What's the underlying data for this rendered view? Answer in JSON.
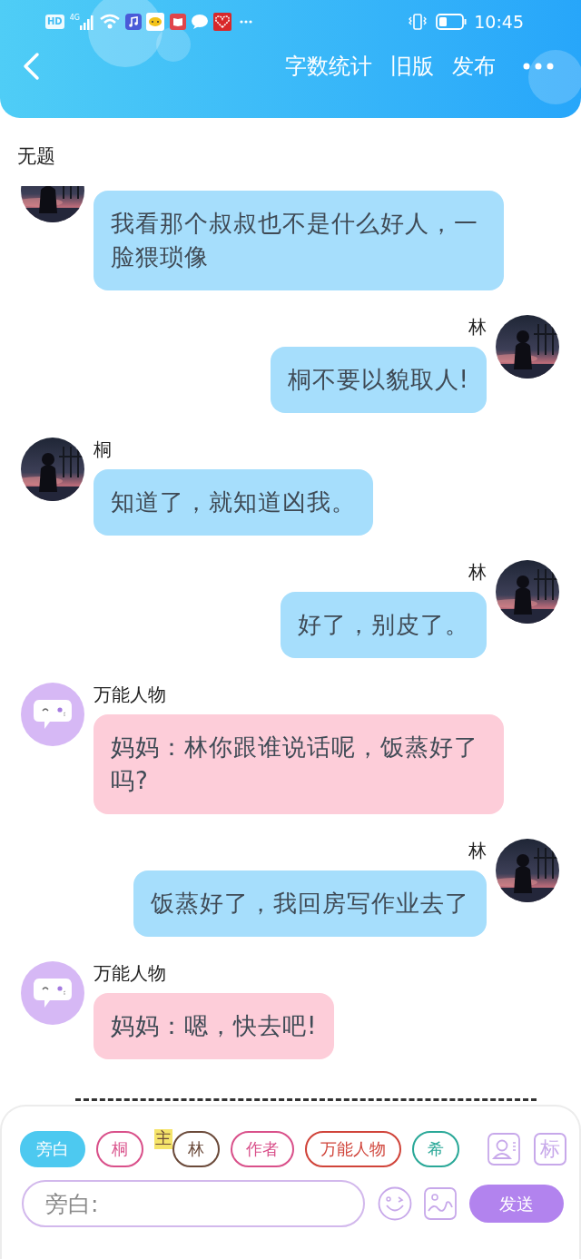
{
  "status_bar": {
    "hd": "HD",
    "network": "4G",
    "time": "10:45"
  },
  "toolbar": {
    "actions": [
      "字数统计",
      "旧版",
      "发布"
    ]
  },
  "title": "无题",
  "messages": [
    {
      "outgoing": false,
      "text": "我看那个叔叔也不是什么好人，一脸猥琐像",
      "color": "#a6defc"
    },
    {
      "outgoing": true,
      "name": "林",
      "text": "桐不要以貌取人!",
      "color": "#a6defc"
    },
    {
      "outgoing": false,
      "name": "桐",
      "text": "知道了，就知道凶我。",
      "color": "#a6defc"
    },
    {
      "outgoing": true,
      "name": "林",
      "text": "好了，别皮了。",
      "color": "#a6defc"
    },
    {
      "outgoing": false,
      "kind": "universal",
      "name": "万能人物",
      "text": "妈妈：林你跟谁说话呢，饭蒸好了吗?",
      "color": "#fdcdd9"
    },
    {
      "outgoing": true,
      "name": "林",
      "text": "饭蒸好了，我回房写作业去了",
      "color": "#a6defc"
    },
    {
      "outgoing": false,
      "kind": "universal",
      "name": "万能人物",
      "text": "妈妈：嗯，快去吧!",
      "color": "#fdcdd9"
    }
  ],
  "roles": [
    {
      "label": "旁白",
      "selected": true,
      "color": "#4dc9f0"
    },
    {
      "label": "桐",
      "selected": false,
      "color": "#d9508a"
    },
    {
      "label": "林",
      "selected": false,
      "color": "#6b4a3a",
      "badge": "主"
    },
    {
      "label": "作者",
      "selected": false,
      "color": "#d9508a"
    },
    {
      "label": "万能人物",
      "selected": false,
      "color": "#d0443a"
    },
    {
      "label": "希",
      "selected": false,
      "color": "#2aa898"
    }
  ],
  "tag_button": "标",
  "input": {
    "placeholder": "旁白:"
  },
  "send_button": "发送"
}
